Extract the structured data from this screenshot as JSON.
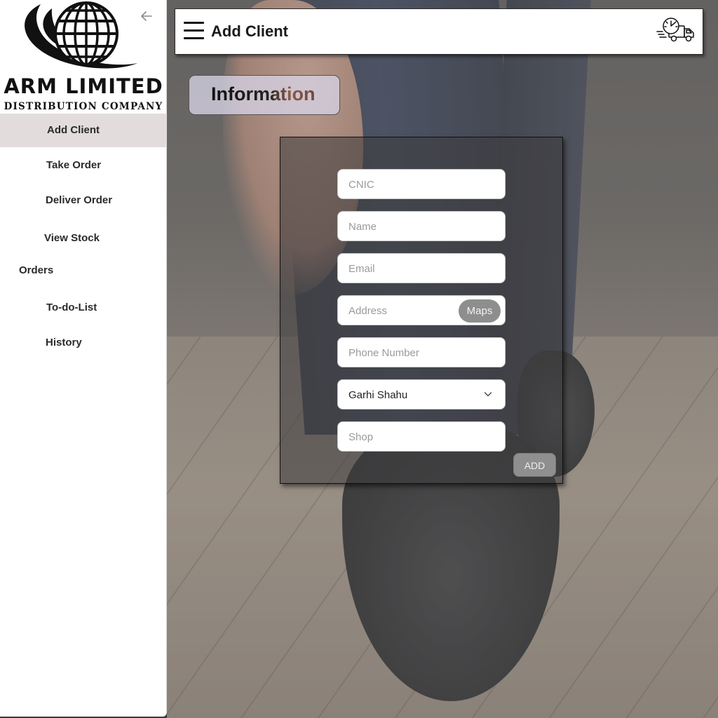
{
  "brand": {
    "name": "ARM LIMITED",
    "tagline": "DISTRIBUTION COMPANY"
  },
  "sidebar": {
    "collapse_icon": "arrow-left-icon",
    "items": [
      {
        "label": "Add Client",
        "active": true
      },
      {
        "label": "Take Order"
      },
      {
        "label": "Deliver Order"
      },
      {
        "label": "View Stock"
      },
      {
        "label": "Orders"
      },
      {
        "label": "To-do-List"
      },
      {
        "label": "History"
      }
    ]
  },
  "header": {
    "title": "Add Client",
    "menu_icon": "hamburger-menu-icon",
    "right_icon": "fast-delivery-truck-icon"
  },
  "section": {
    "title": "Information"
  },
  "form": {
    "cnic": {
      "placeholder": "CNIC"
    },
    "name": {
      "placeholder": "Name"
    },
    "email": {
      "placeholder": "Email"
    },
    "address": {
      "placeholder": "Address",
      "maps_label": "Maps"
    },
    "phone": {
      "placeholder": "Phone Number"
    },
    "area": {
      "selected": "Garhi Shahu"
    },
    "shop": {
      "placeholder": "Shop"
    },
    "submit_label": "ADD"
  },
  "colors": {
    "sidebar_active": "#e2dcdc",
    "button_gray": "#8f8f8f",
    "badge_bg": "#d6d2e4"
  }
}
